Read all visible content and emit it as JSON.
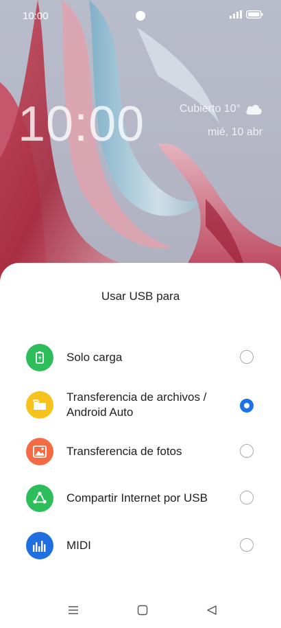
{
  "status_bar": {
    "time": "10:00",
    "signal_icon": "signal-icon",
    "battery_icon": "battery-icon"
  },
  "lock_screen": {
    "clock": "10:00",
    "weather": "Cubierto 10°",
    "weather_icon": "cloud-icon",
    "date": "mié, 10 abr"
  },
  "dialog": {
    "title": "Usar USB para",
    "options": [
      {
        "label": "Solo carga",
        "icon": "battery-charge-icon",
        "color": "#2dbd5a",
        "selected": false
      },
      {
        "label": "Transferencia de archivos / Android Auto",
        "icon": "folder-icon",
        "color": "#f6c21c",
        "selected": true
      },
      {
        "label": "Transferencia de fotos",
        "icon": "image-icon",
        "color": "#f26b43",
        "selected": false
      },
      {
        "label": "Compartir Internet por USB",
        "icon": "share-icon",
        "color": "#2dbd5a",
        "selected": false
      },
      {
        "label": "MIDI",
        "icon": "equalizer-icon",
        "color": "#1f6fe0",
        "selected": false
      }
    ]
  },
  "colors": {
    "accent": "#1a73e8",
    "radio_border": "#a9a9a9"
  },
  "nav_bar": {
    "icons": [
      "menu-icon",
      "home-icon",
      "back-icon"
    ]
  }
}
